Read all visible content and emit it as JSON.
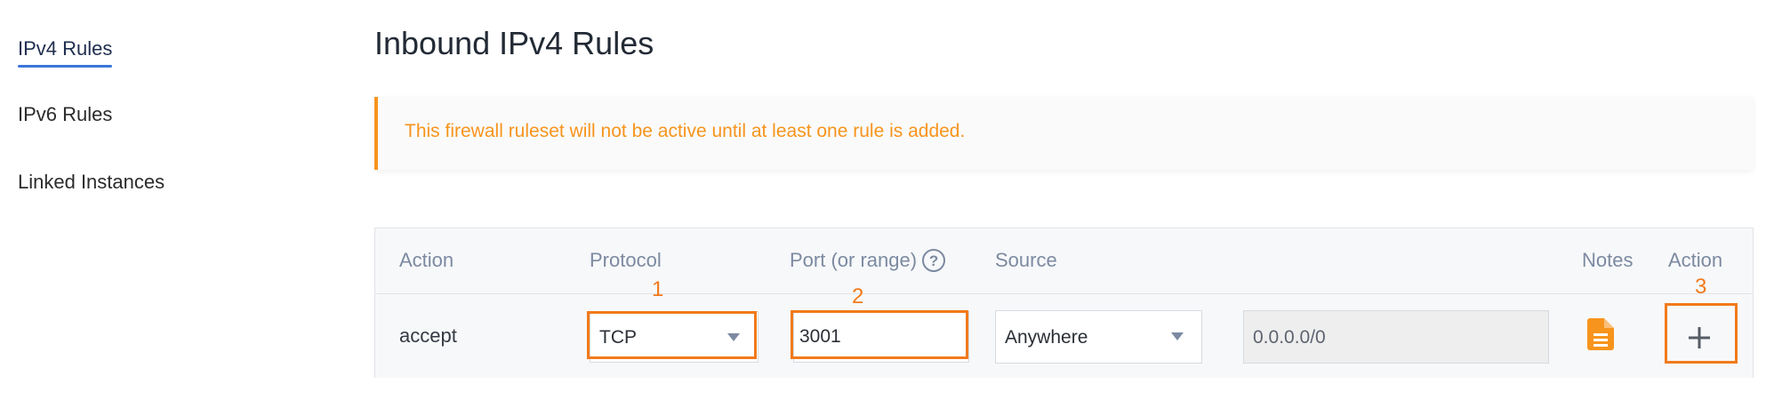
{
  "sidebar": {
    "items": [
      {
        "label": "IPv4 Rules",
        "active": true
      },
      {
        "label": "IPv6 Rules",
        "active": false
      },
      {
        "label": "Linked Instances",
        "active": false
      }
    ]
  },
  "page": {
    "title": "Inbound IPv4 Rules"
  },
  "alert": {
    "message": "This firewall ruleset will not be active until at least one rule is added.",
    "color": "#f7941d"
  },
  "table": {
    "columns": [
      "Action",
      "Protocol",
      "Port (or range)",
      "Source",
      "Notes",
      "Action"
    ],
    "row": {
      "action": "accept",
      "protocol": "TCP",
      "port": "3001",
      "source": "Anywhere",
      "cidr": "0.0.0.0/0",
      "notes_icon": "document-icon",
      "add_icon": "plus-icon"
    }
  },
  "annotations": {
    "labels": [
      "1",
      "2",
      "3"
    ],
    "color": "#f27a1a"
  }
}
